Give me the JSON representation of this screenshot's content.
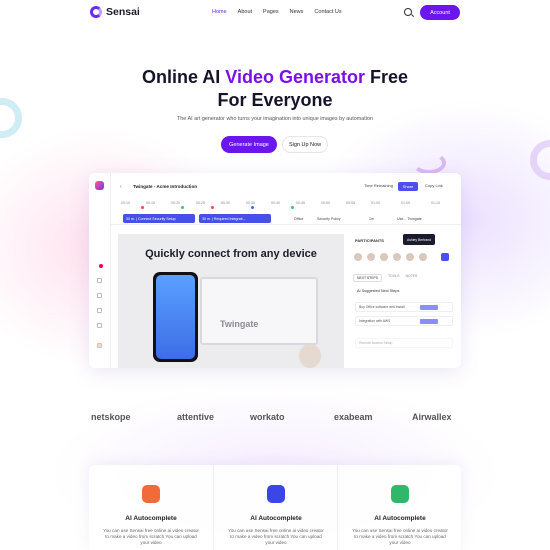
{
  "nav": {
    "logo": "Sensai",
    "items": [
      "Home",
      "About",
      "Pages",
      "News",
      "Contact Us"
    ],
    "account": "Account"
  },
  "hero": {
    "title_pre": "Online AI ",
    "title_highlight": "Video Generator",
    "title_post": " Free",
    "title_line2": "For Everyone",
    "subtitle": "The AI art generator who turns your imagination into unique images by automation",
    "primary_button": "Generate Image",
    "secondary_button": "Sign Up Now"
  },
  "app": {
    "title": "Twingate - Acme Introduction",
    "time_remaining": "Time Remaining",
    "share": "Share",
    "copy_link": "Copy Link",
    "ruler": [
      "00:10",
      "00:15",
      "00:20",
      "00:25",
      "00:30",
      "00:35",
      "00:40",
      "00:45",
      "00:50",
      "00:55",
      "01:00",
      "01:05",
      "01:10"
    ],
    "clips": [
      "30 m.  |  Connect Security Setup",
      "30 m.  |  Required Integrati..."
    ],
    "track_labels": [
      "Office",
      "Security Policy",
      "1m",
      "Use... Twingate"
    ],
    "stage_title": "Quickly connect from any device",
    "stage_brand": "Twingate",
    "participants": "PARTICIPANTS",
    "tooltip": "Ashley Bertrand",
    "panel_tabs": [
      "NEXT STEPS",
      "TOOLS",
      "NOTES"
    ],
    "suggested": "AI Suggested Next Steps",
    "next_steps": [
      "Buy Office software and install",
      "Integration with AWS",
      "Remote Access Setup"
    ]
  },
  "logos": [
    "netskope",
    "attentive",
    "workato",
    "exabeam",
    "Airwallex"
  ],
  "features": [
    {
      "title": "AI Autocomplete",
      "text": "You can use Sensai free online ai video creator to make a video from scratch You can upload your video",
      "color": "#f06a3a"
    },
    {
      "title": "AI Autocomplete",
      "text": "You can use Sensai free online ai video creator to make a video from scratch You can upload your video",
      "color": "#3a46e8"
    },
    {
      "title": "AI Autocomplete",
      "text": "You can use Sensai free online ai video creator to make a video from scratch You can upload your video",
      "color": "#2fb86a"
    }
  ],
  "colors": {
    "accent": "#6b15ef",
    "highlight": "#7a10e8"
  }
}
